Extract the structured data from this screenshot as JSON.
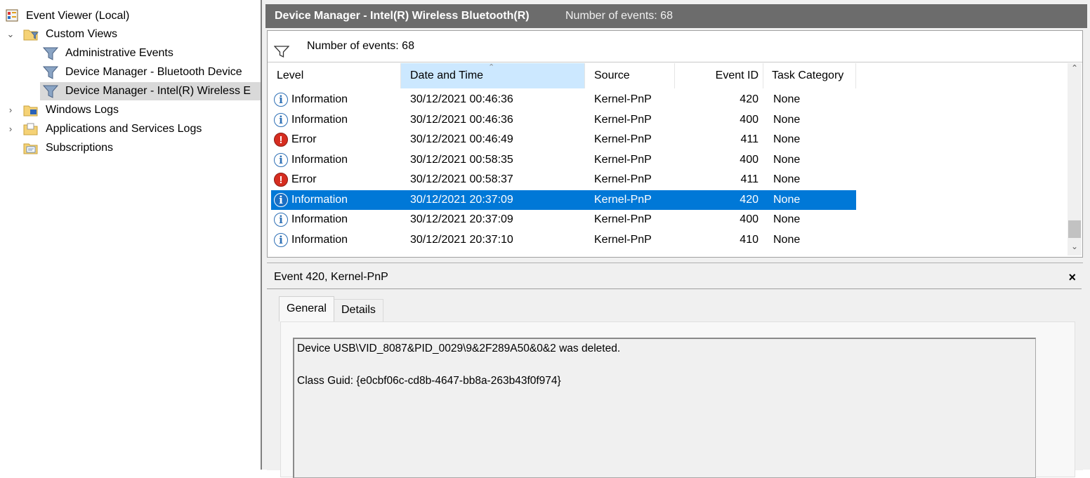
{
  "tree": {
    "root": {
      "label": "Event Viewer (Local)"
    },
    "custom_views": {
      "label": "Custom Views"
    },
    "custom_view_items": [
      {
        "label": "Administrative Events"
      },
      {
        "label": "Device Manager - Bluetooth Device"
      },
      {
        "label": "Device Manager - Intel(R) Wireless E",
        "selected": true
      }
    ],
    "windows_logs": {
      "label": "Windows Logs"
    },
    "app_services_logs": {
      "label": "Applications and Services Logs"
    },
    "subscriptions": {
      "label": "Subscriptions"
    }
  },
  "header": {
    "view_title": "Device Manager - Intel(R) Wireless Bluetooth(R)",
    "event_count": "Number of events: 68"
  },
  "filter_bar": {
    "text": "Number of events: 68",
    "icon": "filter-icon"
  },
  "columns": [
    {
      "label": "Level"
    },
    {
      "label": "Date and Time",
      "sorted": true
    },
    {
      "label": "Source"
    },
    {
      "label": "Event ID"
    },
    {
      "label": "Task Category"
    }
  ],
  "events": [
    {
      "level": "Information",
      "icon": "info-icon",
      "date": "30/12/2021 00:46:36",
      "source": "Kernel-PnP",
      "event_id": "420",
      "task": "None"
    },
    {
      "level": "Information",
      "icon": "info-icon",
      "date": "30/12/2021 00:46:36",
      "source": "Kernel-PnP",
      "event_id": "400",
      "task": "None"
    },
    {
      "level": "Error",
      "icon": "error-icon",
      "date": "30/12/2021 00:46:49",
      "source": "Kernel-PnP",
      "event_id": "411",
      "task": "None"
    },
    {
      "level": "Information",
      "icon": "info-icon",
      "date": "30/12/2021 00:58:35",
      "source": "Kernel-PnP",
      "event_id": "400",
      "task": "None"
    },
    {
      "level": "Error",
      "icon": "error-icon",
      "date": "30/12/2021 00:58:37",
      "source": "Kernel-PnP",
      "event_id": "411",
      "task": "None"
    },
    {
      "level": "Information",
      "icon": "info-icon",
      "date": "30/12/2021 20:37:09",
      "source": "Kernel-PnP",
      "event_id": "420",
      "task": "None",
      "selected": true
    },
    {
      "level": "Information",
      "icon": "info-icon",
      "date": "30/12/2021 20:37:09",
      "source": "Kernel-PnP",
      "event_id": "400",
      "task": "None"
    },
    {
      "level": "Information",
      "icon": "info-icon",
      "date": "30/12/2021 20:37:10",
      "source": "Kernel-PnP",
      "event_id": "410",
      "task": "None"
    }
  ],
  "detail": {
    "title": "Event 420, Kernel-PnP",
    "close_glyph": "×",
    "tabs": [
      {
        "label": "General",
        "active": true
      },
      {
        "label": "Details"
      }
    ],
    "message_line1": "Device USB\\VID_8087&PID_0029\\9&2F289A50&0&2 was deleted.",
    "message_line2": "Class Guid: {e0cbf06c-cd8b-4647-bb8a-263b43f0f974}"
  },
  "colors": {
    "selection": "#0078d7",
    "title_bar": "#6c6c6c",
    "sorted_header": "#cce8ff",
    "error_red": "#d62d20",
    "info_blue": "#2d6fb5"
  }
}
